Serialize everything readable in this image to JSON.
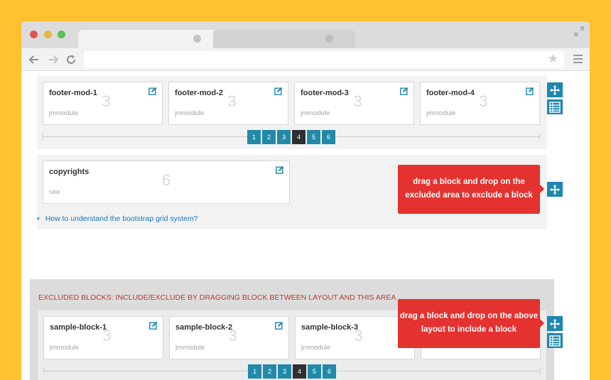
{
  "browser": {
    "title": "",
    "address": ""
  },
  "footer_row": {
    "blocks": [
      {
        "title": "footer-mod-1",
        "type": "jmmodule",
        "size": "3"
      },
      {
        "title": "footer-mod-2",
        "type": "jmmodule",
        "size": "3"
      },
      {
        "title": "footer-mod-3",
        "type": "jmmodule",
        "size": "3"
      },
      {
        "title": "footer-mod-4",
        "type": "jmmodule",
        "size": "3"
      }
    ],
    "pager": [
      "1",
      "2",
      "3",
      "4",
      "5",
      "6"
    ],
    "pager_active": "4"
  },
  "copyright_row": {
    "blocks": [
      {
        "title": "copyrights",
        "type": "raw",
        "size": "6"
      }
    ]
  },
  "tooltips": {
    "exclude": "drag a block and drop on the excluded area to exclude a block",
    "include": "drag a block and drop on the above layout to include a block"
  },
  "links": [
    {
      "label": "How to understand the bootstrap grid system?"
    }
  ],
  "excluded": {
    "title": "EXCLUDED BLOCKS: INCLUDE/EXCLUDE BY DRAGGING BLOCK BETWEEN LAYOUT AND THIS AREA",
    "blocks": [
      {
        "title": "sample-block-1",
        "type": "jmmodule",
        "size": "3"
      },
      {
        "title": "sample-block-2",
        "type": "jmmodule",
        "size": "3"
      },
      {
        "title": "sample-block-3",
        "type": "jmmodule",
        "size": "3"
      }
    ],
    "pager": [
      "1",
      "2",
      "3",
      "4",
      "5",
      "6"
    ],
    "pager_active": "4"
  },
  "icons": {
    "edit": "edit-icon",
    "move": "move-icon",
    "list": "list-icon"
  },
  "colors": {
    "background": "#fec12f",
    "accent": "#2289a9",
    "tooltip": "#e3322f",
    "excluded_title": "#b0402b"
  }
}
